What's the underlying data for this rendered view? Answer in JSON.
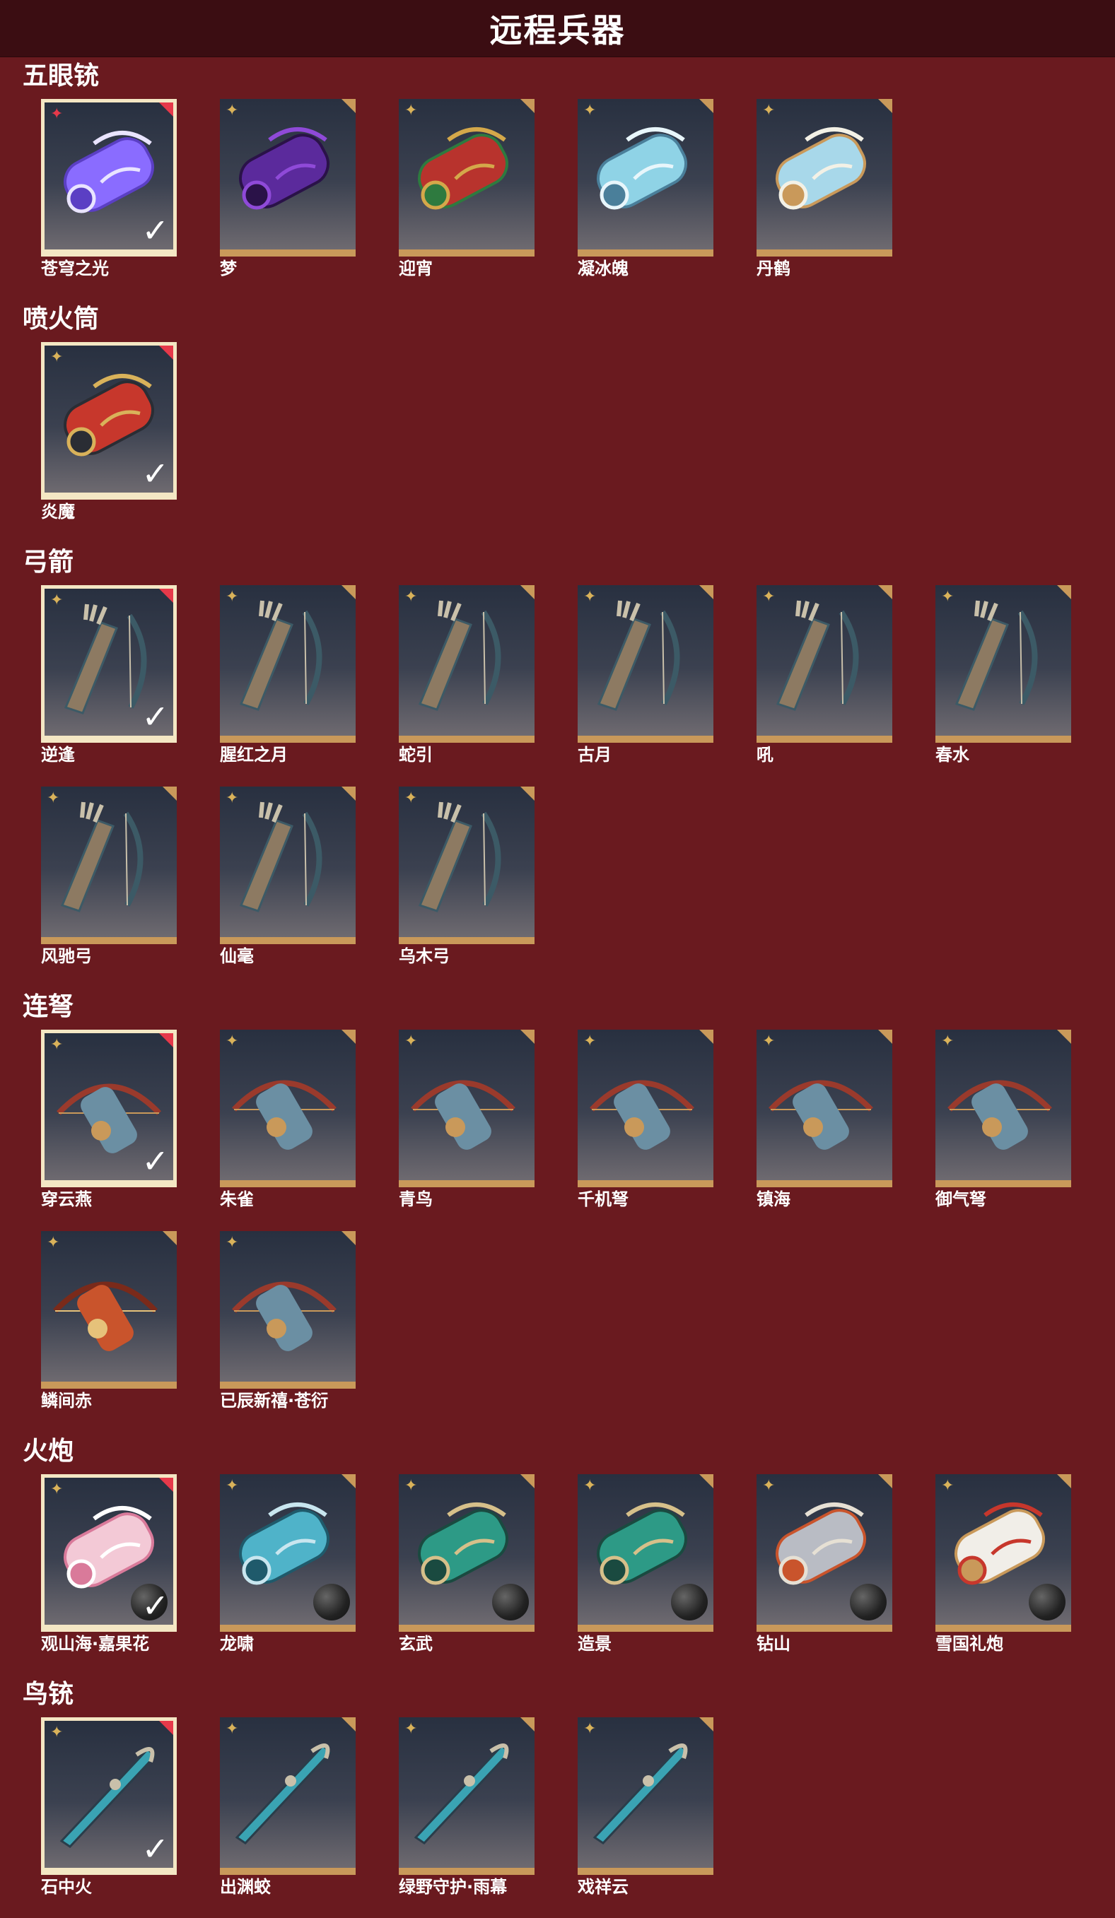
{
  "header": {
    "title": "远程兵器"
  },
  "colors": {
    "background": "#6a1a1f",
    "header": "#3b0d12",
    "card_frame": "#c9995a",
    "selected_frame": "#f4e7c4",
    "accent_red": "#e6394a"
  },
  "sections": [
    {
      "label": "五眼铳",
      "items": [
        {
          "name": "苍穹之光",
          "selected": true,
          "badge": "red-star-icon",
          "art": "glowing-purple-cannon"
        },
        {
          "name": "梦",
          "selected": false,
          "art": "purple-cannon"
        },
        {
          "name": "迎宵",
          "selected": false,
          "art": "red-gold-cannon"
        },
        {
          "name": "凝冰魄",
          "selected": false,
          "art": "ice-cannon"
        },
        {
          "name": "丹鹤",
          "selected": false,
          "art": "crane-cannon"
        }
      ]
    },
    {
      "label": "喷火筒",
      "items": [
        {
          "name": "炎魔",
          "selected": true,
          "art": "flame-tube"
        }
      ]
    },
    {
      "label": "弓箭",
      "items": [
        {
          "name": "逆逢",
          "selected": true,
          "art": "bow-quiver"
        },
        {
          "name": "腥红之月",
          "selected": false,
          "art": "bow-quiver"
        },
        {
          "name": "蛇引",
          "selected": false,
          "art": "bow-quiver"
        },
        {
          "name": "古月",
          "selected": false,
          "art": "bow-quiver"
        },
        {
          "name": "吼",
          "selected": false,
          "art": "bow-quiver"
        },
        {
          "name": "春水",
          "selected": false,
          "art": "bow-quiver"
        },
        {
          "name": "风驰弓",
          "selected": false,
          "art": "bow-quiver"
        },
        {
          "name": "仙毫",
          "selected": false,
          "art": "bow-quiver"
        },
        {
          "name": "乌木弓",
          "selected": false,
          "art": "bow-quiver"
        }
      ]
    },
    {
      "label": "连弩",
      "items": [
        {
          "name": "穿云燕",
          "selected": true,
          "art": "crossbow"
        },
        {
          "name": "朱雀",
          "selected": false,
          "art": "crossbow"
        },
        {
          "name": "青鸟",
          "selected": false,
          "art": "crossbow"
        },
        {
          "name": "千机弩",
          "selected": false,
          "art": "crossbow"
        },
        {
          "name": "镇海",
          "selected": false,
          "art": "crossbow"
        },
        {
          "name": "御气弩",
          "selected": false,
          "art": "crossbow"
        },
        {
          "name": "鳞间赤",
          "selected": false,
          "art": "fish-crossbow"
        },
        {
          "name": "已辰新禧·苍衍",
          "selected": false,
          "art": "crossbow"
        }
      ]
    },
    {
      "label": "火炮",
      "items": [
        {
          "name": "观山海·嘉果花",
          "selected": true,
          "ball": true,
          "art": "flower-cannon"
        },
        {
          "name": "龙啸",
          "selected": false,
          "ball": true,
          "art": "dragon-cannon"
        },
        {
          "name": "玄武",
          "selected": false,
          "ball": true,
          "art": "jade-cannon"
        },
        {
          "name": "造景",
          "selected": false,
          "ball": true,
          "art": "jade-cannon"
        },
        {
          "name": "钻山",
          "selected": false,
          "ball": true,
          "art": "silver-cannon"
        },
        {
          "name": "雪国礼炮",
          "selected": false,
          "ball": true,
          "art": "white-cannon"
        }
      ]
    },
    {
      "label": "鸟铳",
      "items": [
        {
          "name": "石中火",
          "selected": true,
          "art": "musket"
        },
        {
          "name": "出渊蛟",
          "selected": false,
          "art": "musket"
        },
        {
          "name": "绿野守护·雨幕",
          "selected": false,
          "art": "musket"
        },
        {
          "name": "戏祥云",
          "selected": false,
          "art": "musket"
        }
      ]
    }
  ]
}
